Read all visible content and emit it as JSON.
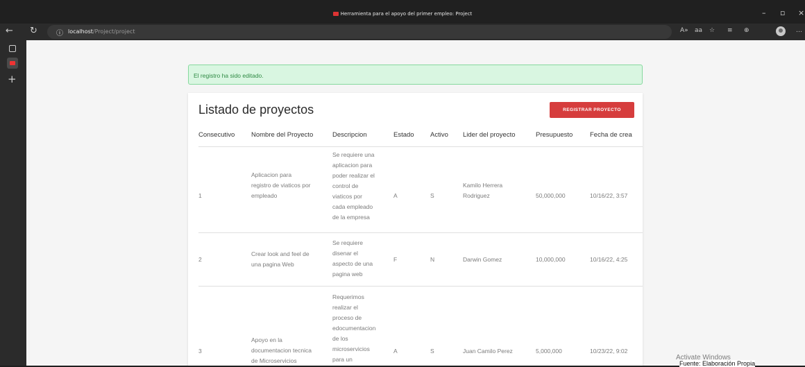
{
  "window": {
    "title": "Herramienta para el apoyo del primer empleo: Project"
  },
  "address": {
    "host": "localhost",
    "path": "/Project/project"
  },
  "alert": {
    "message": "El registro ha sido editado."
  },
  "card": {
    "title": "Listado de proyectos",
    "register_label": "REGISTRAR PROYECTO"
  },
  "table": {
    "headers": [
      "Consecutivo",
      "Nombre del Proyecto",
      "Descripcion",
      "Estado",
      "Activo",
      "Lider del proyecto",
      "Presupuesto",
      "Fecha de crea"
    ],
    "rows": [
      {
        "id": "1",
        "name": "Aplicacion para\nregistro de viaticos por\nempleado",
        "description": "Se requiere una\naplicacion para\npoder realizar el\ncontrol de\nviaticos por\ncada empleado\nde la empresa",
        "status": "A",
        "active": "S",
        "leader": "Kamilo Herrera\nRodriguez",
        "budget": "50,000,000",
        "date": "10/16/22, 3:57"
      },
      {
        "id": "2",
        "name": "Crear look and feel de\nuna pagina Web",
        "description": "Se requiere\ndisenar el\naspecto de una\npagina web",
        "status": "F",
        "active": "N",
        "leader": "Darwin Gomez",
        "budget": "10,000,000",
        "date": "10/16/22, 4:25"
      },
      {
        "id": "3",
        "name": "Apoyo en la\ndocumentacion tecnica\nde Microservicios",
        "description": "Requerimos\nrealizar el\nproceso de\nedocumentacion\nde los\nmicroservicios\npara un",
        "status": "A",
        "active": "S",
        "leader": "Juan Camilo Perez",
        "budget": "5,000,000",
        "date": "10/23/22, 9:02"
      }
    ]
  },
  "watermark": {
    "text": "Activate Windows"
  },
  "caption": {
    "text": "Fuente: Elaboración Propia"
  },
  "colors": {
    "accent": "#d63d3d",
    "alert_bg": "#d9f6e1",
    "alert_text": "#2f8a44"
  }
}
